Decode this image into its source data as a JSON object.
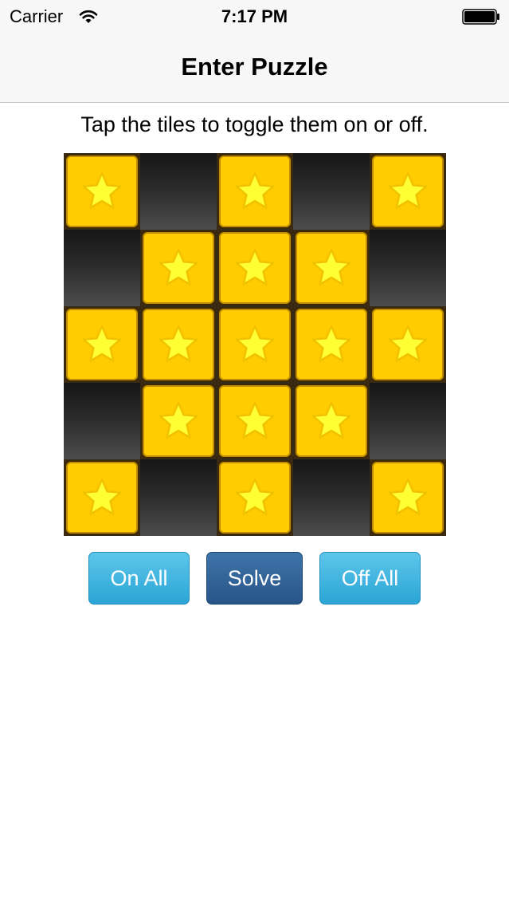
{
  "status_bar": {
    "carrier": "Carrier",
    "time": "7:17 PM",
    "wifi_icon": "wifi-icon",
    "battery_icon": "battery-icon"
  },
  "nav": {
    "title": "Enter Puzzle"
  },
  "instruction": "Tap the tiles to toggle them on or off.",
  "grid": {
    "rows": 5,
    "cols": 5,
    "tile_icon": "star-icon",
    "on_color": "#ffcc00",
    "star_color": "#ffff33",
    "cells": [
      [
        1,
        0,
        1,
        0,
        1
      ],
      [
        0,
        1,
        1,
        1,
        0
      ],
      [
        1,
        1,
        1,
        1,
        1
      ],
      [
        0,
        1,
        1,
        1,
        0
      ],
      [
        1,
        0,
        1,
        0,
        1
      ]
    ]
  },
  "buttons": {
    "on_all": "On All",
    "solve": "Solve",
    "off_all": "Off All"
  }
}
